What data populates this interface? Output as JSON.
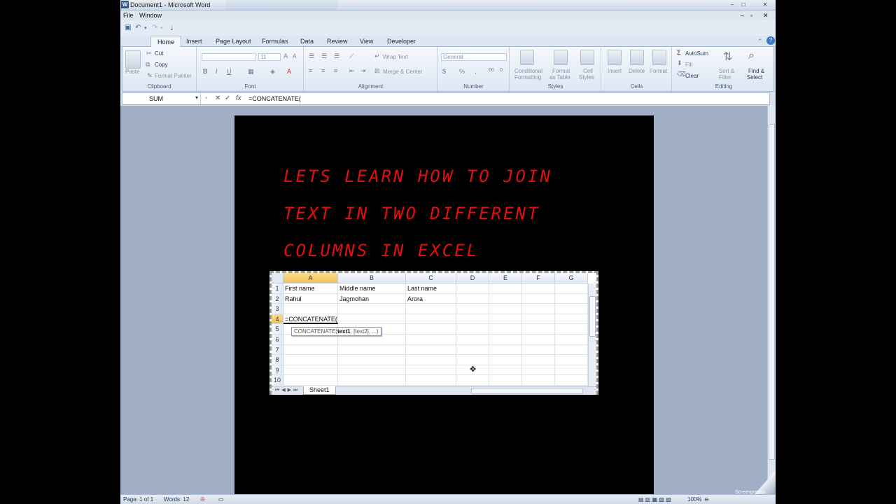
{
  "window": {
    "title": "Document1 - Microsoft Word"
  },
  "menu": [
    "File",
    "Window"
  ],
  "tabs": [
    "Home",
    "Insert",
    "Page Layout",
    "Formulas",
    "Data",
    "Review",
    "View",
    "Developer"
  ],
  "ribbon": {
    "clipboard": {
      "label": "Clipboard",
      "paste": "Paste",
      "cut": "Cut",
      "copy": "Copy",
      "format_painter": "Format Painter"
    },
    "font": {
      "label": "Font",
      "size": "11"
    },
    "alignment": {
      "label": "Alignment",
      "wrap_text": "Wrap Text",
      "merge_center": "Merge & Center"
    },
    "number": {
      "label": "Number",
      "format": "General"
    },
    "styles": {
      "label": "Styles",
      "conditional": "Conditional",
      "formatting": "Formatting",
      "format": "Format",
      "as_table": "as Table",
      "cell": "Cell",
      "cell_styles": "Styles"
    },
    "cells": {
      "label": "Cells",
      "insert": "Insert",
      "delete": "Delete",
      "format": "Format"
    },
    "editing": {
      "label": "Editing",
      "autosum": "AutoSum",
      "fill": "Fill",
      "clear": "Clear",
      "sort": "Sort &",
      "filter": "Filter",
      "find": "Find &",
      "select": "Select"
    }
  },
  "formula_bar": {
    "name_box": "SUM",
    "formula": "=CONCATENATE("
  },
  "document": {
    "heading_lines": [
      "LETS LEARN HOW TO JOIN",
      "TEXT IN TWO DIFFERENT",
      "COLUMNS IN EXCEL"
    ]
  },
  "sheet": {
    "columns": [
      "A",
      "B",
      "C",
      "D",
      "E",
      "F",
      "G"
    ],
    "rows": [
      "1",
      "2",
      "3",
      "4",
      "5",
      "6",
      "7",
      "8",
      "9",
      "10"
    ],
    "cells": {
      "A1": "First name",
      "B1": "Middle name",
      "C1": "Last name",
      "A2": "Rahul",
      "B2": "Jagmohan",
      "C2": "Arora",
      "A4": "=CONCATENATE("
    },
    "tooltip": {
      "fn": "CONCATENATE(",
      "arg1": "text1",
      "rest": ", [text2], ...)"
    },
    "sheet_tab": "Sheet1"
  },
  "status": {
    "page": "Page: 1 of 1",
    "words": "Words: 12",
    "zoom": "100%"
  },
  "watermark": "Screenpresso"
}
